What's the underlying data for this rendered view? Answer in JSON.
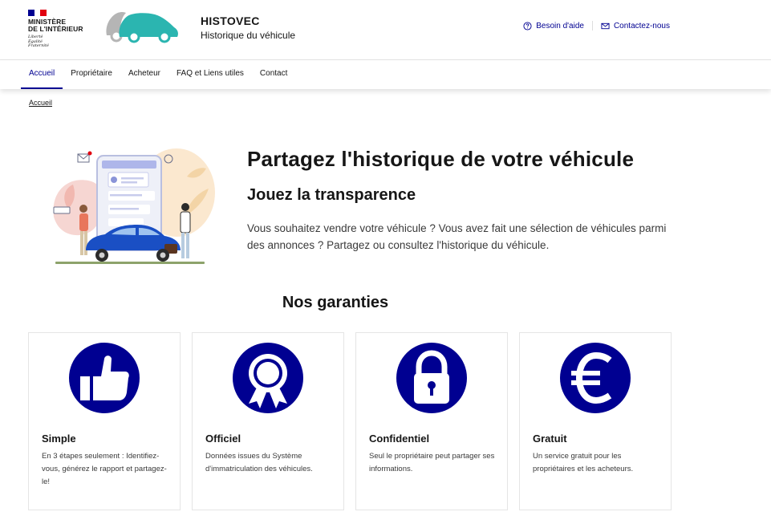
{
  "header": {
    "ministry_line1": "Ministère",
    "ministry_line2": "de l'Intérieur",
    "motto_1": "Liberté",
    "motto_2": "Égalité",
    "motto_3": "Fraternité",
    "service_title": "HISTOVEC",
    "service_tagline": "Historique du véhicule",
    "tools": [
      {
        "label": "Besoin d'aide",
        "icon": "help-circle-icon"
      },
      {
        "label": "Contactez-nous",
        "icon": "mail-icon"
      }
    ]
  },
  "nav": {
    "items": [
      {
        "label": "Accueil",
        "active": true
      },
      {
        "label": "Propriétaire",
        "active": false
      },
      {
        "label": "Acheteur",
        "active": false
      },
      {
        "label": "FAQ et Liens utiles",
        "active": false
      },
      {
        "label": "Contact",
        "active": false
      }
    ]
  },
  "breadcrumb": {
    "current": "Accueil"
  },
  "hero": {
    "title": "Partagez l'historique de votre véhicule",
    "subtitle": "Jouez la transparence",
    "text": "Vous souhaitez vendre votre véhicule ? Vous avez fait une sélection de véhicules parmi des annonces ? Partagez ou consultez l'historique du véhicule."
  },
  "guarantees": {
    "title": "Nos garanties",
    "cards": [
      {
        "title": "Simple",
        "description": "En 3 étapes seulement : Identifiez-vous, générez le rapport et partagez-le!",
        "icon": "thumbs-up-icon"
      },
      {
        "title": "Officiel",
        "description": "Données issues du Système d'immatriculation des véhicules.",
        "icon": "award-ribbon-icon"
      },
      {
        "title": "Confidentiel",
        "description": "Seul le propriétaire peut partager ses informations.",
        "icon": "padlock-icon"
      },
      {
        "title": "Gratuit",
        "description": "Un service gratuit pour les propriétaires et les acheteurs.",
        "icon": "euro-icon"
      }
    ]
  },
  "colors": {
    "primary": "#000091",
    "logo_teal": "#2bb5b0",
    "logo_grey": "#b5b5b5"
  }
}
